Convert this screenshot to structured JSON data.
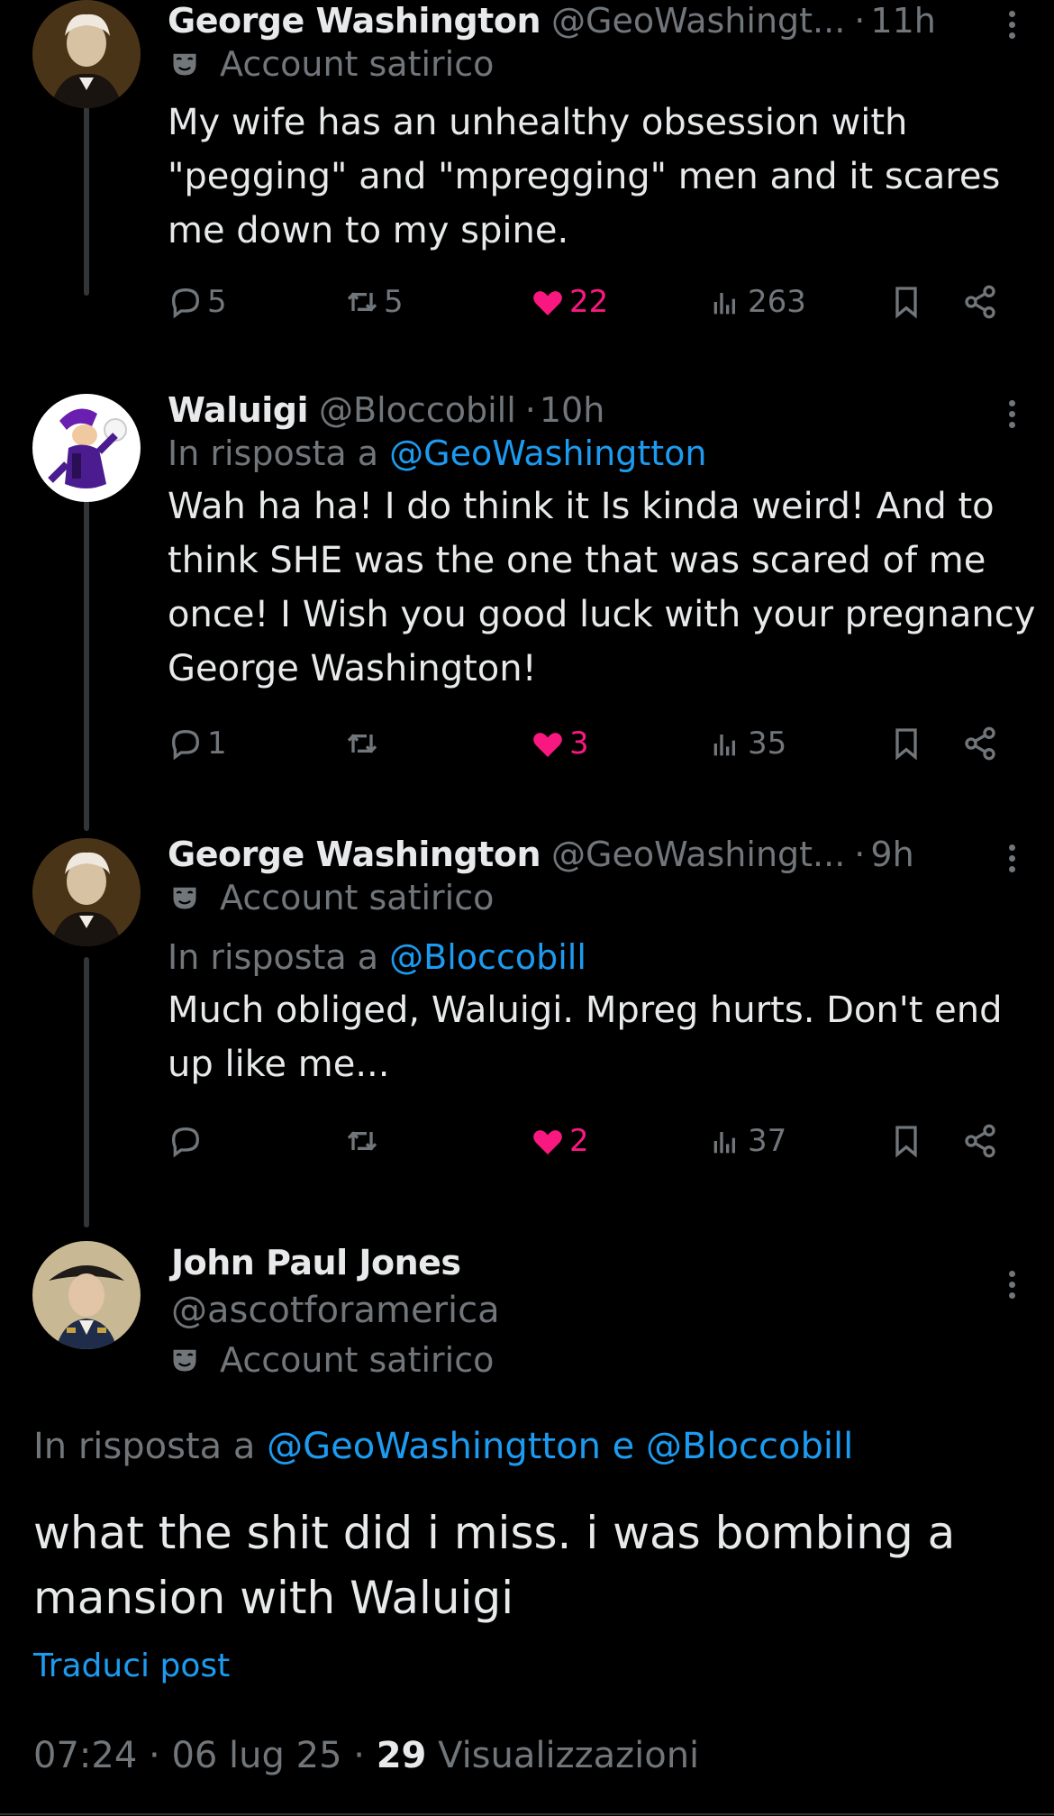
{
  "colors": {
    "accent": "#1d9bf0",
    "like": "#f91880",
    "muted": "#71767b",
    "text": "#e7e9ea",
    "background": "#000000"
  },
  "tweets": [
    {
      "name": "George Washington",
      "handle": "@GeoWashingt...",
      "time": "11h",
      "badge": "Account satirico",
      "text": "My wife has an unhealthy obsession with \"pegging\" and \"mpregging\" men and it scares me down to my spine.",
      "replies": "5",
      "retweets": "5",
      "likes": "22",
      "views": "263"
    },
    {
      "name": "Waluigi",
      "handle": "@Bloccobill",
      "time": "10h",
      "reply_prefix": "In risposta a",
      "reply_mention": "@GeoWashingtton",
      "text": "Wah ha ha! I do think it Is kinda weird! And to think SHE was the one that was scared of me once! I Wish you good luck with your pregnancy George Washington!",
      "replies": "1",
      "retweets": "",
      "likes": "3",
      "views": "35"
    },
    {
      "name": "George Washington",
      "handle": "@GeoWashingt...",
      "time": "9h",
      "badge": "Account satirico",
      "reply_prefix": "In risposta a",
      "reply_mention": "@Bloccobill",
      "text": "Much obliged, Waluigi. Mpreg hurts. Don't end up like me...",
      "replies": "",
      "retweets": "",
      "likes": "2",
      "views": "37"
    }
  ],
  "main_post": {
    "name": "John Paul Jones",
    "handle": "@ascotforamerica",
    "badge": "Account satirico",
    "reply_prefix": "In risposta a",
    "mention1": "@GeoWashingtton",
    "conjunction": "e",
    "mention2": "@Bloccobill",
    "text": "what the shit did i miss. i was bombing a mansion with Waluigi",
    "translate": "Traduci post",
    "time": "07:24",
    "date": "06 lug 25",
    "views_count": "29",
    "views_label": "Visualizzazioni"
  },
  "icons": [
    "reply-icon",
    "retweet-icon",
    "like-icon",
    "views-icon",
    "bookmark-icon",
    "share-icon",
    "more-icon",
    "satire-mask-icon"
  ]
}
